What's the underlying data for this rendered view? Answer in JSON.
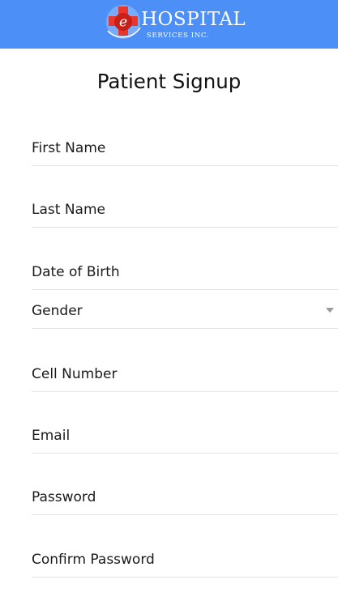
{
  "header": {
    "logo": {
      "badge_letter": "e",
      "name": "HOSPITAL",
      "tagline": "SERVICES INC."
    },
    "background_color": "#4b8ff7"
  },
  "page_title": "Patient Signup",
  "form": {
    "fields": [
      {
        "label": "First Name",
        "type": "text",
        "value": ""
      },
      {
        "label": "Last Name",
        "type": "text",
        "value": ""
      },
      {
        "label": "Date of Birth",
        "type": "date",
        "value": ""
      },
      {
        "label": "Gender",
        "type": "select",
        "value": ""
      },
      {
        "label": "Cell Number",
        "type": "tel",
        "value": ""
      },
      {
        "label": "Email",
        "type": "email",
        "value": ""
      },
      {
        "label": "Password",
        "type": "password",
        "value": ""
      },
      {
        "label": "Confirm Password",
        "type": "password",
        "value": ""
      }
    ]
  },
  "icons": {
    "gender_dropdown": "chevron-down-icon",
    "logo_badge": "medical-cross-icon"
  }
}
